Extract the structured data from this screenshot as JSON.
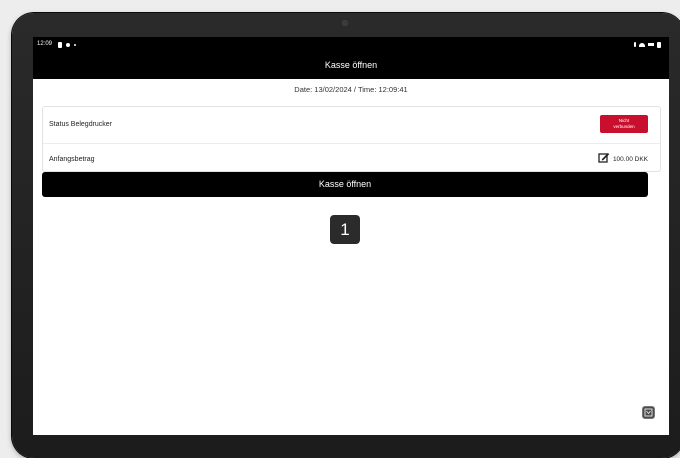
{
  "statusbar": {
    "time": "12:09"
  },
  "appbar": {
    "title": "Kasse öffnen"
  },
  "datetime": {
    "text": "Date: 13/02/2024 / Time: 12:09:41"
  },
  "printer_row": {
    "label": "Status Belegdrucker",
    "badge_line1": "Nicht",
    "badge_line2": "verbunden",
    "badge_color": "#c8102e"
  },
  "amount_row": {
    "label": "Anfangsbetrag",
    "value": "100.00 DKK"
  },
  "primary_button": {
    "label": "Kasse öffnen"
  },
  "step_marker": {
    "number": "1"
  },
  "icons": [
    "edit-icon",
    "wifi-icon",
    "battery-icon",
    "bluetooth-icon"
  ]
}
